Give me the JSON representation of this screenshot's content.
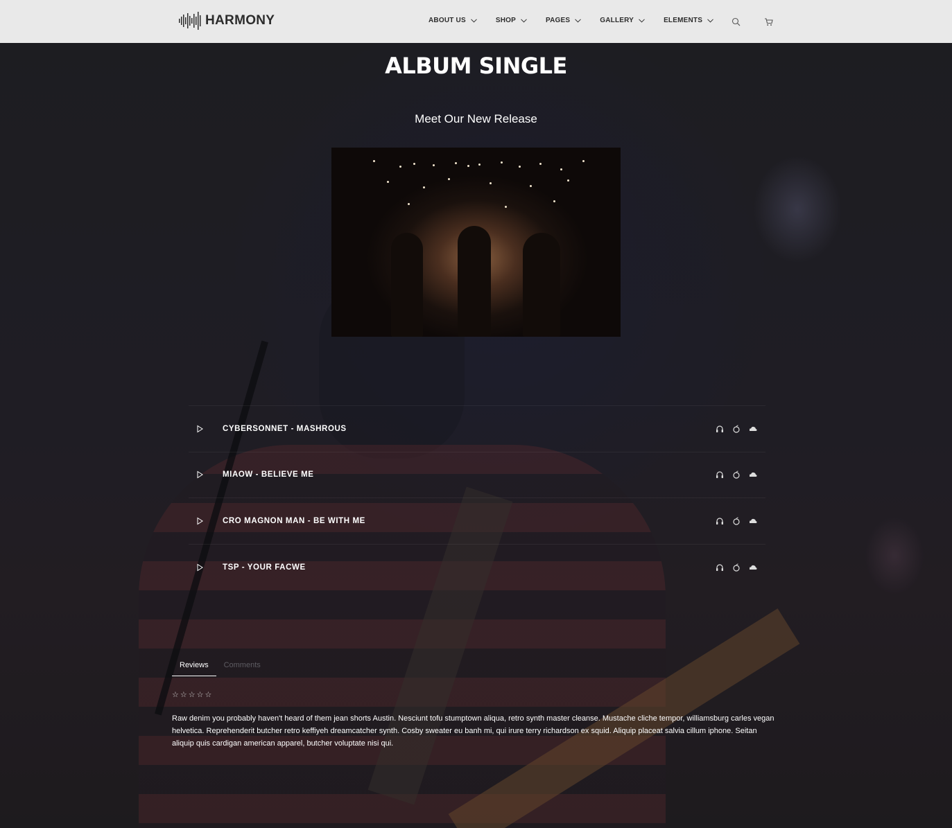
{
  "header": {
    "logo_text": "HARMONY",
    "nav": [
      {
        "label": "ABOUT US"
      },
      {
        "label": "SHOP"
      },
      {
        "label": "PAGES"
      },
      {
        "label": "GALLERY"
      },
      {
        "label": "ELEMENTS"
      }
    ],
    "icons": [
      "search-icon",
      "cart-icon"
    ]
  },
  "page": {
    "title": "ALBUM SINGLE",
    "subtitle": "Meet Our New Release"
  },
  "tracks": [
    {
      "name": "CYBERSONNET - MASHROUS"
    },
    {
      "name": "MIAOW - BELIEVE ME"
    },
    {
      "name": "CRO MAGNON MAN - BE WITH ME"
    },
    {
      "name": "TSP - YOUR FACWE"
    }
  ],
  "track_icons": [
    "headphones-icon",
    "apple-icon",
    "soundcloud-icon"
  ],
  "tabs": [
    {
      "label": "Reviews",
      "active": true
    },
    {
      "label": "Comments",
      "active": false
    }
  ],
  "review": {
    "stars": "☆☆☆☆☆",
    "text": "Raw denim you probably haven't heard of them jean shorts Austin. Nesciunt tofu stumptown aliqua, retro synth master cleanse. Mustache cliche tempor, williamsburg carles vegan helvetica. Reprehenderit butcher retro keffiyeh dreamcatcher synth. Cosby sweater eu banh mi, qui irure terry richardson ex squid. Aliquip placeat salvia cillum iphone. Seitan aliquip quis cardigan american apparel, butcher voluptate nisi qui."
  },
  "colors": {
    "header_bg": "#e9e9e9",
    "page_bg": "#1f1d22",
    "text_primary": "#ffffff",
    "text_dark": "#2c2c2c"
  }
}
